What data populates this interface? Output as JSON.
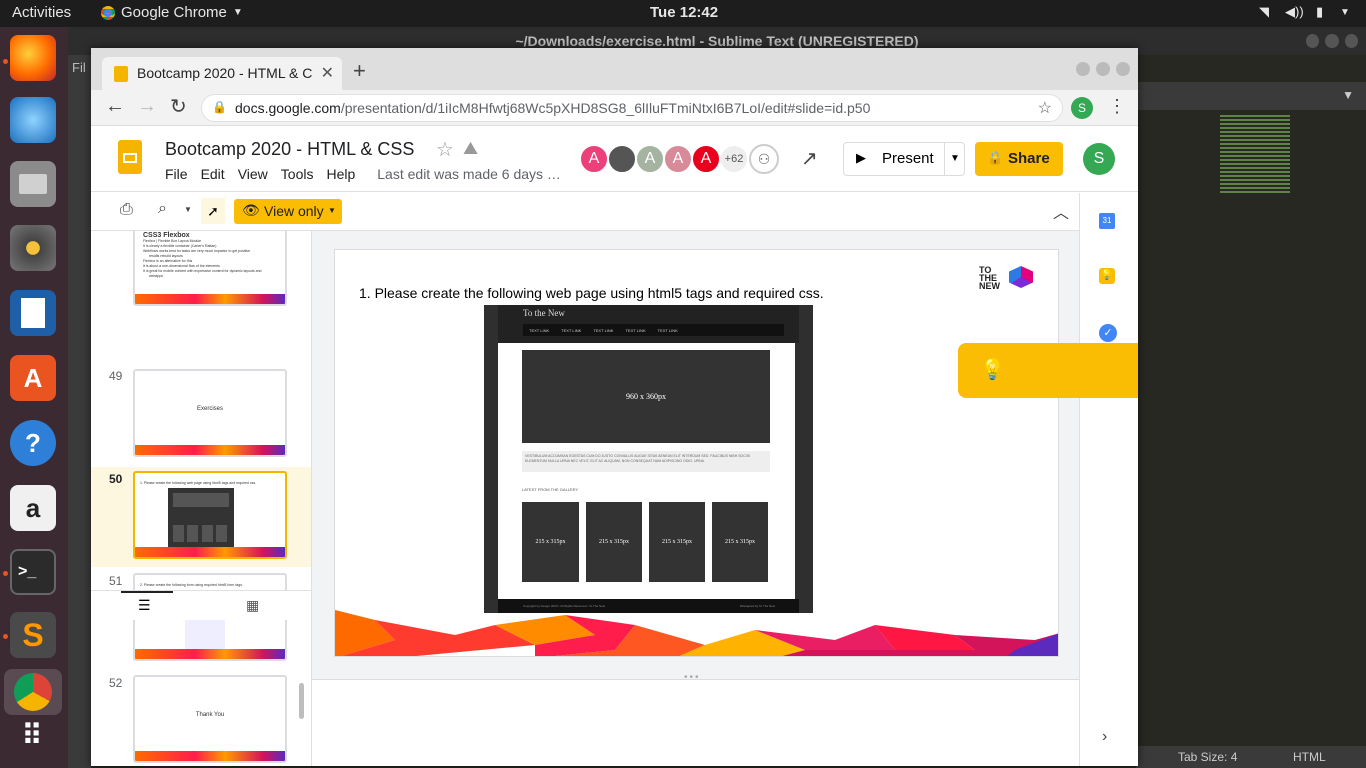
{
  "system": {
    "activities": "Activities",
    "app": "Google Chrome",
    "clock": "Tue 12:42"
  },
  "sublime": {
    "title": "~/Downloads/exercise.html - Sublime Text (UNREGISTERED)",
    "tab_size": "Tab Size: 4",
    "syntax": "HTML",
    "menu_fragment": "Fil"
  },
  "chrome": {
    "tab_title": "Bootcamp 2020 - HTML & C",
    "url_host": "docs.google.com",
    "url_path": "/presentation/d/1iIcM8Hfwtj68Wc5pXHD8SG8_6lIluFTmiNtxI6B7LoI/edit#slide=id.p50",
    "profile": "S"
  },
  "slides": {
    "doc_title": "Bootcamp 2020 - HTML & CSS",
    "menus": [
      "File",
      "Edit",
      "View",
      "Tools",
      "Help"
    ],
    "last_edit": "Last edit was made 6 days …",
    "collaborators": [
      "A",
      "",
      "A",
      "A",
      "A"
    ],
    "collab_colors": [
      "#ec407a",
      "#555555",
      "#a5b4a0",
      "#d98a99",
      "#e8001c"
    ],
    "more_count": "+62",
    "present": "Present",
    "share": "Share",
    "user": "S",
    "view_only": "View only",
    "thumbs": [
      {
        "num": "",
        "title": "CSS3 Flexbox",
        "lines": [
          "Flexbox | Flexible Box Layout Module",
          "It is clearly a flexible container (Carter's Rattan)",
          "Webflows works best for tasks are very much impactor to get positive",
          "results rebuild layouts",
          "Flexbox is an alternative for this",
          "It is about a one-dimensional flow of the elements",
          "It is great for mobile content with expressive content for dynamic layouts and",
          "webapps"
        ]
      },
      {
        "num": "49",
        "title": "Exercises"
      },
      {
        "num": "50",
        "title": "1. Please create the following web page using html5 tags and required css."
      },
      {
        "num": "51",
        "title": "2. Please create the following form using required html5 form tags."
      },
      {
        "num": "52",
        "title": "Thank You"
      }
    ],
    "slide": {
      "instruction": "1. Please create the following web page using html5 tags and required css.",
      "logo_text": [
        "TO",
        "THE",
        "NEW"
      ],
      "mock": {
        "site_title": "To the New",
        "nav": [
          "TEXT LINK",
          "TEXT LINK",
          "TEXT LINK",
          "TEXT LINK",
          "TEXT LINK"
        ],
        "hero": "960 x 360px",
        "paragraph": "VESTIBULUM ACCUMSAN EGESTAS CUM DO JUSTO CONVALLIS AUGUE SITAS AENEAN ELIT INTERDUM SED. FAUCIBUS NIBH SOCIIS ELEMENTUM NULLA URNA NEC VELIT, ELIT AC ALIQUAM, NON CONSEQUAT NAM ADIPISCING ODIO. URNA.",
        "gallery_heading": "LATEST FROM THE GALLERY",
        "cards": [
          "215 x 315px",
          "215 x 315px",
          "215 x 315px",
          "215 x 315px"
        ],
        "footer_left": "Copyright by Design 2020 • All Rights Reserved • To The New",
        "footer_right": "#Designed by To The New"
      }
    }
  },
  "colors": {
    "yellow": "#fbbc04",
    "slides_yellow": "#f4b400",
    "green": "#34a853",
    "dock": "#3c2a33"
  }
}
